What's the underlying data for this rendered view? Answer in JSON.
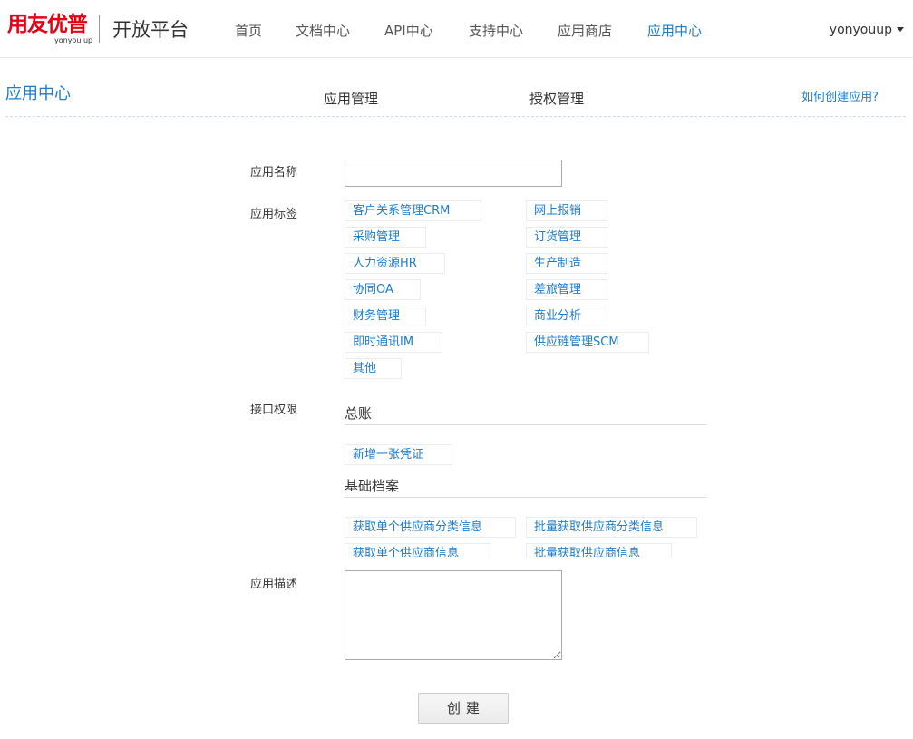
{
  "header": {
    "logo_text": "用友优普",
    "logo_sub": "yonyou up",
    "platform": "开放平台",
    "nav": [
      "首页",
      "文档中心",
      "API中心",
      "支持中心",
      "应用商店",
      "应用中心"
    ],
    "active_nav": "应用中心",
    "user": "yonyouup"
  },
  "subheader": {
    "title": "应用中心",
    "tabs": [
      "应用管理",
      "授权管理"
    ],
    "help": "如何创建应用?"
  },
  "form": {
    "name_label": "应用名称",
    "name_value": "",
    "tags_label": "应用标签",
    "tags": [
      "客户关系管理CRM",
      "网上报销",
      "采购管理",
      "订货管理",
      "人力资源HR",
      "生产制造",
      "协同OA",
      "差旅管理",
      "财务管理",
      "商业分析",
      "即时通讯IM",
      "供应链管理SCM",
      "其他"
    ],
    "api_label": "接口权限",
    "api_groups": [
      {
        "title": "总账",
        "items": [
          "新增一张凭证"
        ]
      },
      {
        "title": "基础档案",
        "items": [
          "获取单个供应商分类信息",
          "批量获取供应商分类信息",
          "获取单个供应商信息",
          "批量获取供应商信息"
        ]
      }
    ],
    "desc_label": "应用描述",
    "desc_value": "",
    "submit": "创建"
  },
  "colors": {
    "brand_red": "#e60012",
    "accent_blue": "#1e7ccc"
  }
}
